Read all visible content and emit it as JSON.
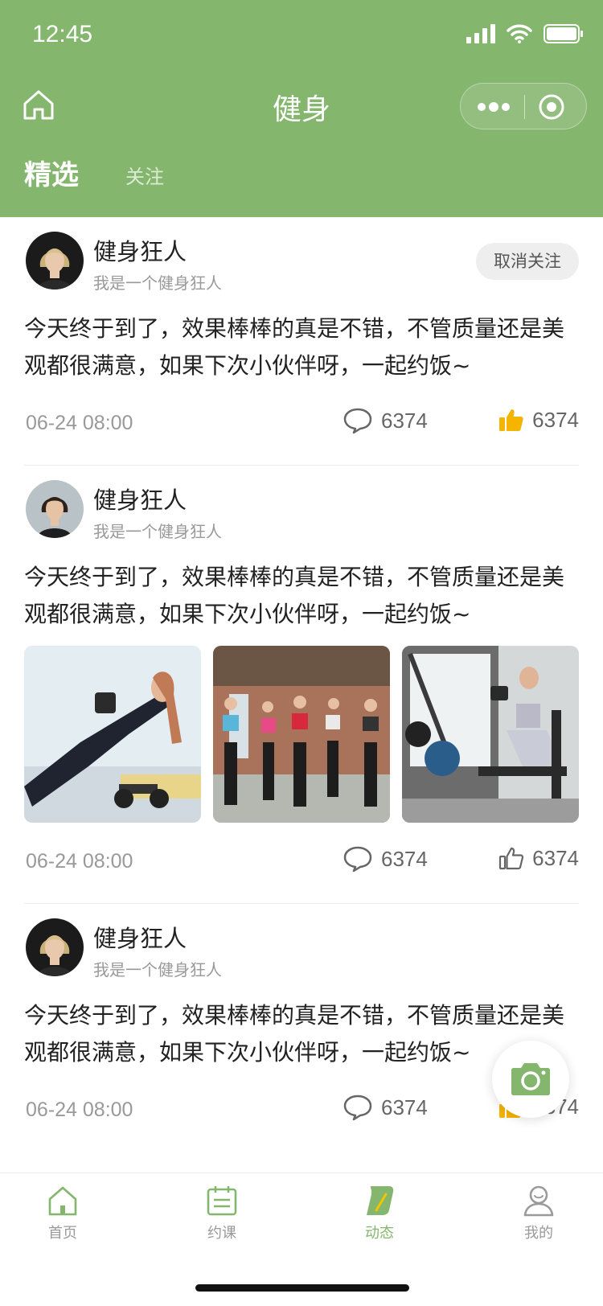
{
  "status_bar": {
    "time": "12:45"
  },
  "nav": {
    "title": "健身"
  },
  "tabs": {
    "featured": "精选",
    "following": "关注"
  },
  "posts": [
    {
      "author": "健身狂人",
      "bio": "我是一个健身狂人",
      "follow_button": "取消关注",
      "text": "今天终于到了，效果棒棒的真是不错，不管质量还是美观都很满意，如果下次小伙伴呀，一起约饭~",
      "date": "06-24  08:00",
      "comments": "6374",
      "likes": "6374",
      "liked": true
    },
    {
      "author": "健身狂人",
      "bio": "我是一个健身狂人",
      "text": "今天终于到了，效果棒棒的真是不错，不管质量还是美观都很满意，如果下次小伙伴呀，一起约饭~",
      "images": [
        "fitness-woman-dumbbell-photo",
        "group-workout-photo",
        "gym-bench-workout-photo"
      ],
      "date": "06-24  08:00",
      "comments": "6374",
      "likes": "6374",
      "liked": false
    },
    {
      "author": "健身狂人",
      "bio": "我是一个健身狂人",
      "text": "今天终于到了，效果棒棒的真是不错，不管质量还是美观都很满意，如果下次小伙伴呀，一起约饭~",
      "date": "06-24  08:00",
      "comments": "6374",
      "likes": "6374",
      "liked": true
    }
  ],
  "tabbar": [
    {
      "label": "首页",
      "icon": "home-icon"
    },
    {
      "label": "约课",
      "icon": "calendar-icon"
    },
    {
      "label": "动态",
      "icon": "moments-icon",
      "active": true
    },
    {
      "label": "我的",
      "icon": "user-icon"
    }
  ],
  "colors": {
    "brand": "#84b66e",
    "like": "#f5b400",
    "muted": "#999999"
  }
}
